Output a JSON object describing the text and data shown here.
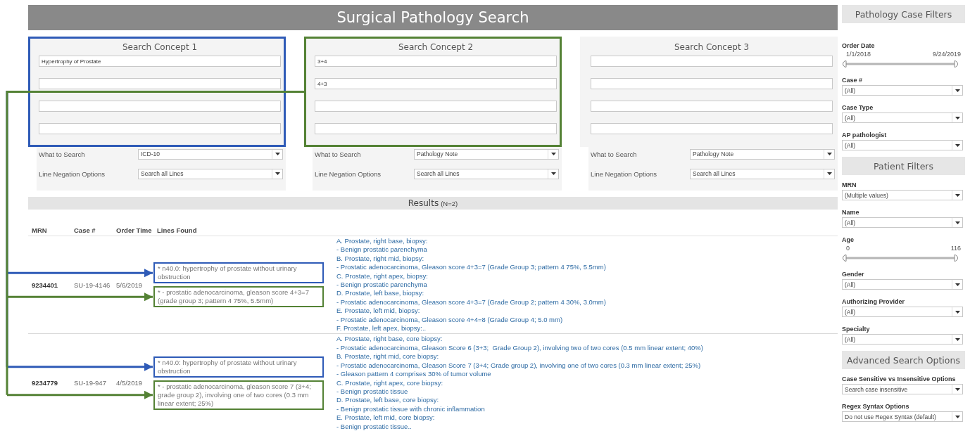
{
  "title": "Surgical Pathology Search",
  "concepts": [
    {
      "heading": "Search Concept 1",
      "color": "#2f5bb7",
      "terms": [
        {
          "kind": "filled",
          "value": "Hypertrophy of Prostate"
        },
        {
          "kind": "empty"
        },
        {
          "kind": "empty"
        },
        {
          "kind": "empty"
        }
      ],
      "options": [
        {
          "label": "What to Search",
          "value": "ICD-10"
        },
        {
          "label": "Line Negation Options",
          "value": "Search all Lines"
        }
      ]
    },
    {
      "heading": "Search Concept 2",
      "color": "#548235",
      "terms": [
        {
          "kind": "filled",
          "value": "3+4"
        },
        {
          "kind": "filled",
          "value": "4+3"
        },
        {
          "kind": "empty"
        },
        {
          "kind": "empty"
        }
      ],
      "options": [
        {
          "label": "What to Search",
          "value": "Pathology Note"
        },
        {
          "label": "Line Negation Options",
          "value": "Search all Lines"
        }
      ]
    },
    {
      "heading": "Search Concept 3",
      "terms": [
        {
          "kind": "empty"
        },
        {
          "kind": "empty"
        },
        {
          "kind": "empty"
        },
        {
          "kind": "empty"
        }
      ],
      "options": [
        {
          "label": "What to Search",
          "value": "Pathology Note"
        },
        {
          "label": "Line Negation Options",
          "value": "Search all Lines"
        }
      ]
    }
  ],
  "results": {
    "title": "Results",
    "count": "(N=2)",
    "columns": [
      "MRN",
      "Case #",
      "Order Time",
      "Lines Found"
    ],
    "rows": [
      {
        "mrn": "9234401",
        "case": "SU-19-4146",
        "order_time": "5/6/2019",
        "lines_found": [
          {
            "text": "* n40.0: hypertrophy of prostate without urinary obstruction",
            "color": "#2f5bb7"
          },
          {
            "text": "* - prostatic adenocarcinoma, gleason score 4+3=7 (grade group 3; pattern 4 75%, 5.5mm)",
            "color": "#548235"
          }
        ],
        "note_lines": [
          "A. Prostate, right base, biopsy:",
          "- Benign prostatic parenchyma",
          "B. Prostate, right mid, biopsy:",
          "- Prostatic adenocarcinoma, Gleason score 4+3=7 (Grade Group 3; pattern 4 75%, 5.5mm)",
          "C. Prostate, right apex, biopsy:",
          "- Benign prostatic parenchyma",
          "D. Prostate, left base, biopsy:",
          "- Prostatic adenocarcinoma, Gleason score 4+3=7 (Grade Group 2; pattern 4 30%, 3.0mm)",
          "E. Prostate, left mid, biopsy:",
          "- Prostatic adenocarcinoma, Gleason score 4+4=8 (Grade Group 4; 5.0 mm)",
          "F. Prostate, left apex, biopsy:.."
        ]
      },
      {
        "mrn": "9234779",
        "case": "SU-19-947",
        "order_time": "4/5/2019",
        "lines_found": [
          {
            "text": "* n40.0: hypertrophy of prostate without urinary obstruction",
            "color": "#2f5bb7"
          },
          {
            "text": "* - prostatic adenocarcinoma, gleason score 7 (3+4; grade group 2), involving one of two cores (0.3 mm linear extent; 25%)",
            "color": "#548235"
          }
        ],
        "note_lines": [
          "A. Prostate, right base, core biopsy:",
          "- Prostatic adenocarcinoma, Gleason Score 6 (3+3;  Grade Group 2), involving two of two cores (0.5 mm linear extent; 40%)",
          "B. Prostate, right mid, core biopsy:",
          "- Prostatic adenocarcinoma, Gleason Score 7 (3+4; Grade group 2), involving one of two cores (0.3 mm linear extent; 25%)",
          "- Gleason pattern 4 comprises 30% of tumor volume",
          "C. Prostate, right apex, core biopsy:",
          "- Benign prostatic tissue",
          "D. Prostate, left base, core biopsy:",
          "- Benign prostatic tissue with chronic inflammation",
          "E. Prostate, left mid, core biopsy:",
          "- Benign prostatic tissue.."
        ]
      }
    ]
  },
  "sidebar": [
    {
      "kind": "header",
      "text": "Pathology Case Filters"
    },
    {
      "kind": "range",
      "label": "Order Date",
      "from": "1/1/2018",
      "to": "9/24/2019",
      "level": 1
    },
    {
      "kind": "dropdown",
      "label": "Case #",
      "value": "(All)"
    },
    {
      "kind": "dropdown",
      "label": "Case Type",
      "value": "(All)"
    },
    {
      "kind": "dropdown",
      "label": "AP pathologist",
      "value": "(All)"
    },
    {
      "kind": "header",
      "text": "Patient Filters"
    },
    {
      "kind": "dropdown",
      "label": "MRN",
      "value": "(Multiple values)"
    },
    {
      "kind": "dropdown",
      "label": "Name",
      "value": "(All)"
    },
    {
      "kind": "range",
      "label": "Age",
      "from": "0",
      "to": "116",
      "level": 1
    },
    {
      "kind": "dropdown",
      "label": "Gender",
      "value": "(All)"
    },
    {
      "kind": "dropdown",
      "label": "Authorizing Provider",
      "value": "(All)"
    },
    {
      "kind": "dropdown",
      "label": "Specialty",
      "value": "(All)"
    },
    {
      "kind": "header",
      "text": "Advanced Search Options"
    },
    {
      "kind": "dropdown",
      "label": "Case Sensitive vs Insensitive Options",
      "value": "Search case insensitive"
    },
    {
      "kind": "dropdown",
      "label": "Regex Syntax Options",
      "value": "Do not use Regex Syntax (default)"
    }
  ]
}
